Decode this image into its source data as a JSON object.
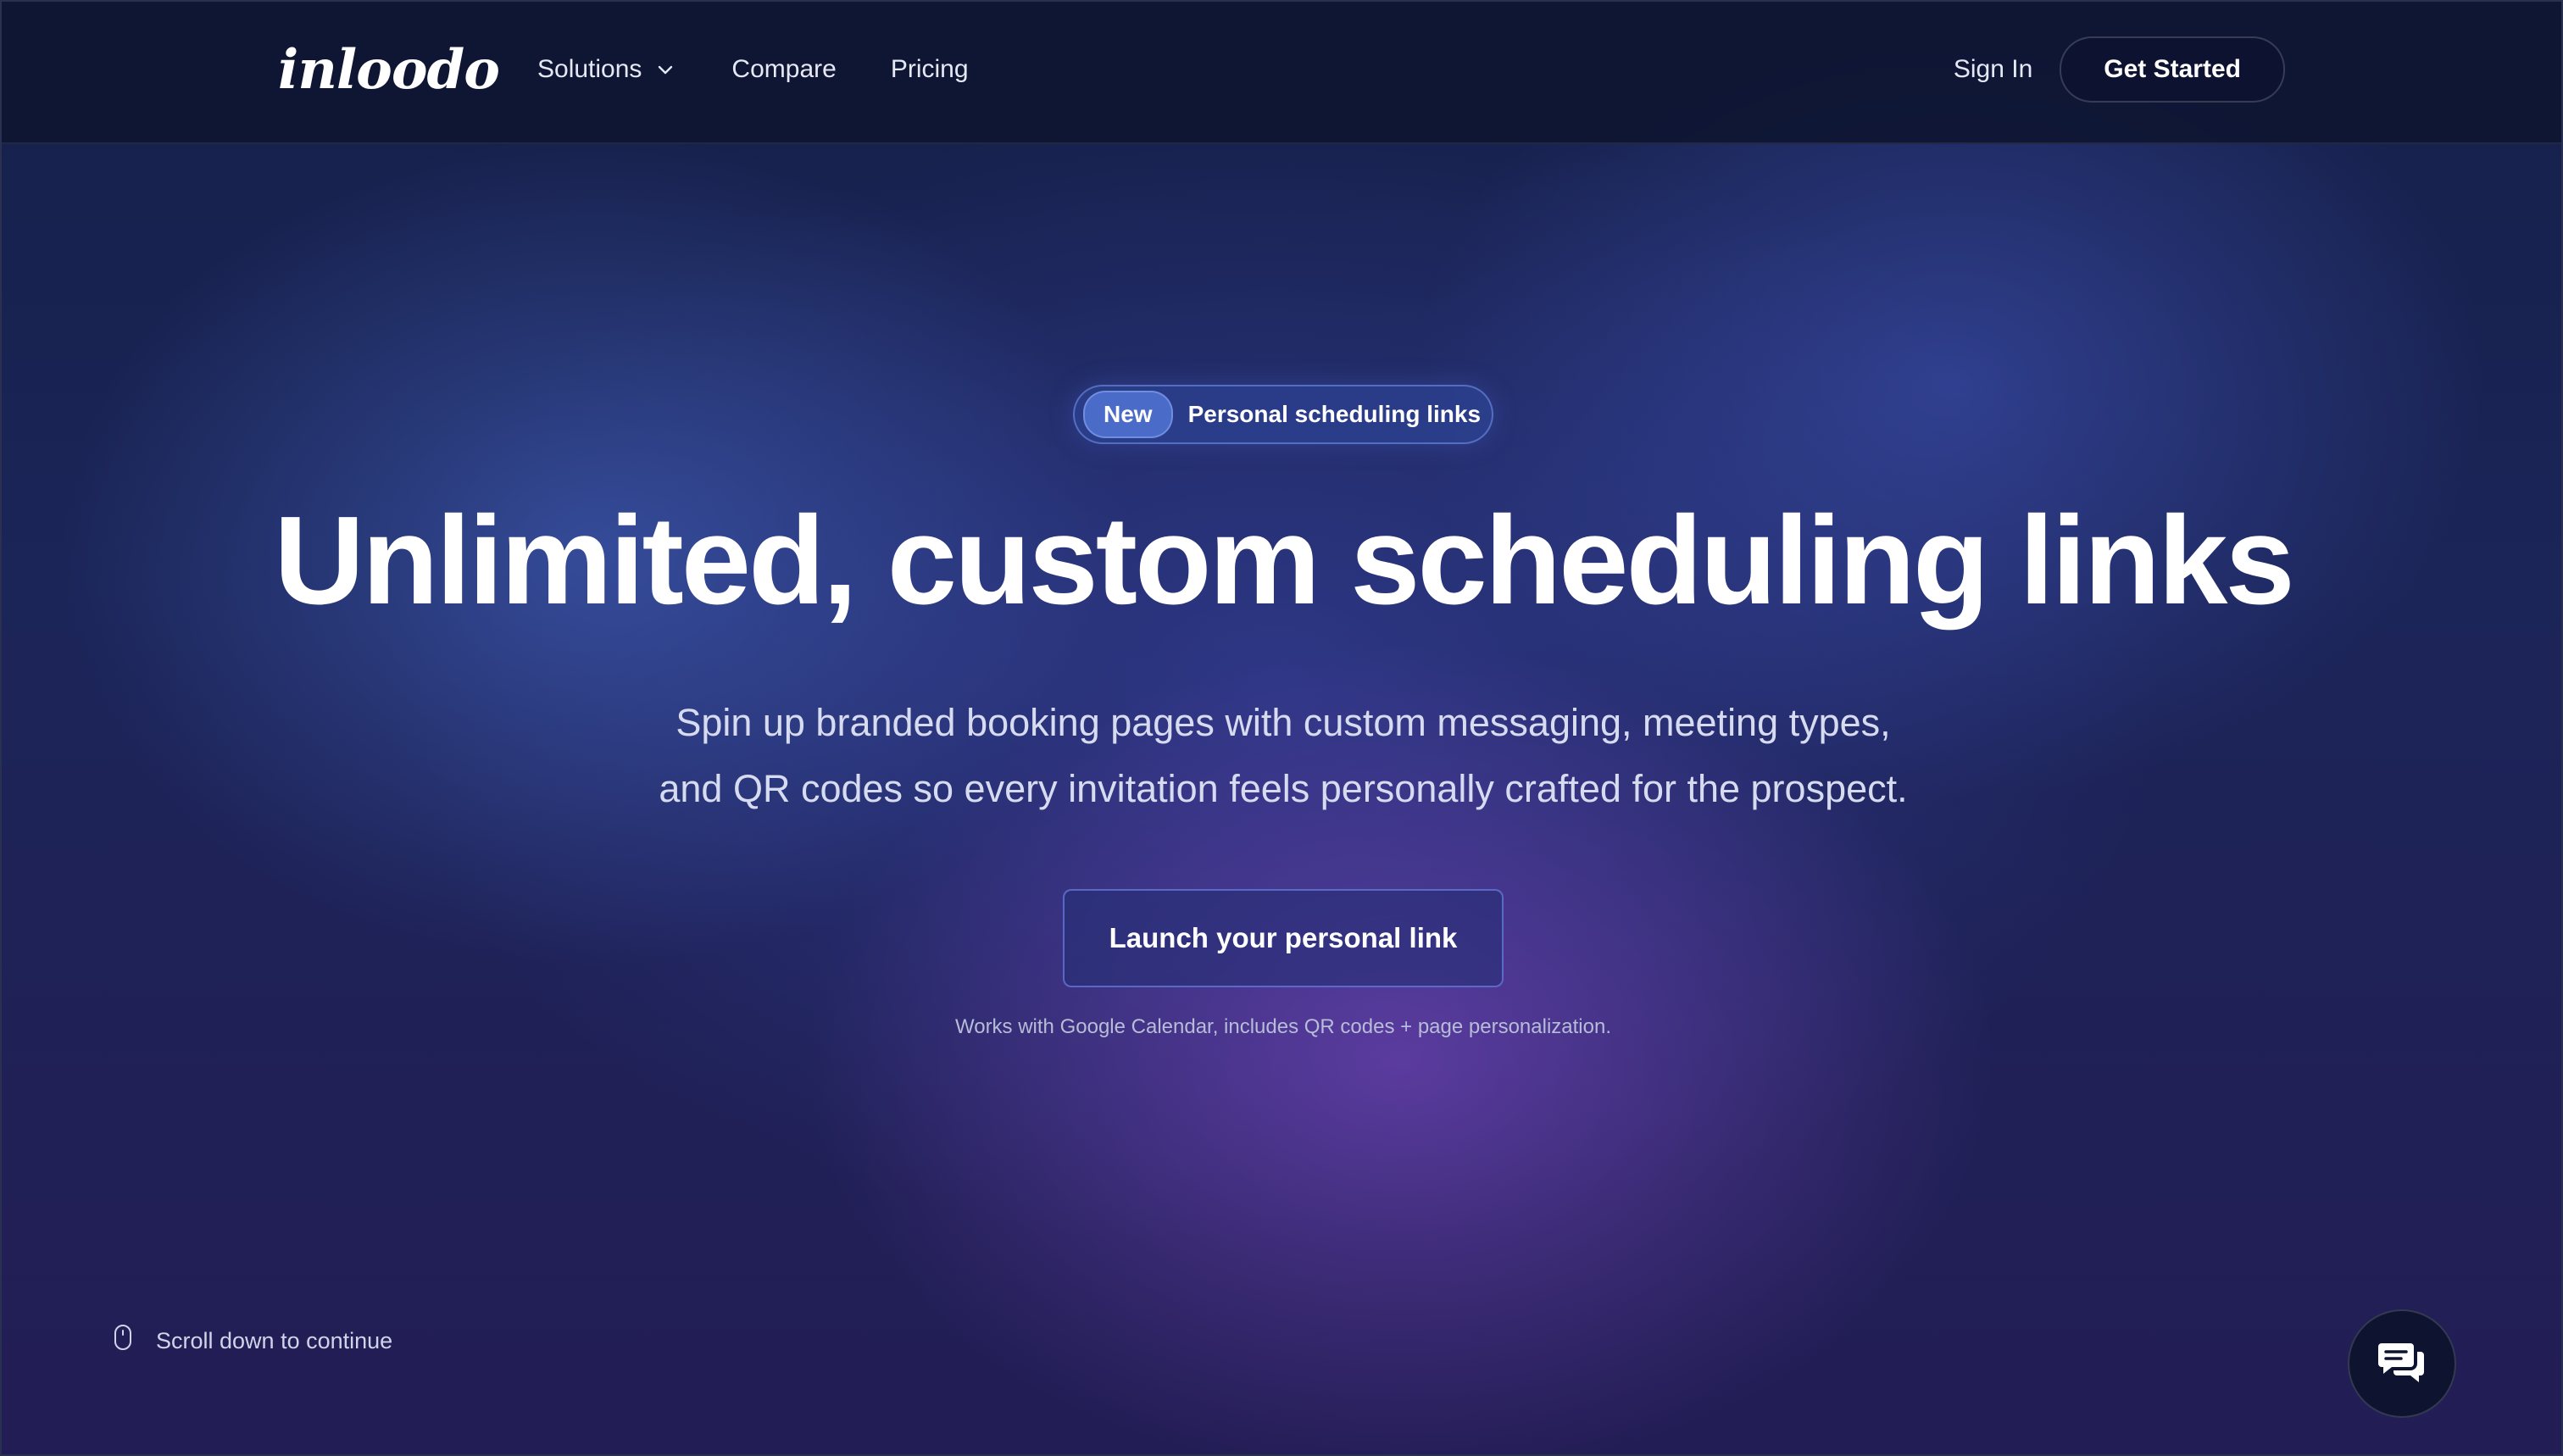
{
  "brand": {
    "logo_text": "inloodo"
  },
  "nav": {
    "solutions_label": "Solutions",
    "compare_label": "Compare",
    "pricing_label": "Pricing"
  },
  "header_actions": {
    "sign_in_label": "Sign In",
    "get_started_label": "Get Started"
  },
  "hero": {
    "badge_tag": "New",
    "badge_text": "Personal scheduling links",
    "headline": "Unlimited, custom scheduling links",
    "subtitle_line1": "Spin up branded booking pages with custom messaging, meeting types,",
    "subtitle_line2": "and QR codes so every invitation feels personally crafted for the prospect.",
    "cta_label": "Launch your personal link",
    "note": "Works with Google Calendar, includes QR codes + page personalization."
  },
  "footer_hint": {
    "scroll_text": "Scroll down to continue",
    "scroll_icon": "mouse-icon"
  },
  "chat": {
    "icon": "chat-bubbles-icon"
  },
  "colors": {
    "background_dark": "#0f1533",
    "accent_blue": "#5073d2",
    "accent_purple": "#7846be",
    "text_primary": "#ffffff",
    "text_secondary": "#d7dbf0"
  }
}
